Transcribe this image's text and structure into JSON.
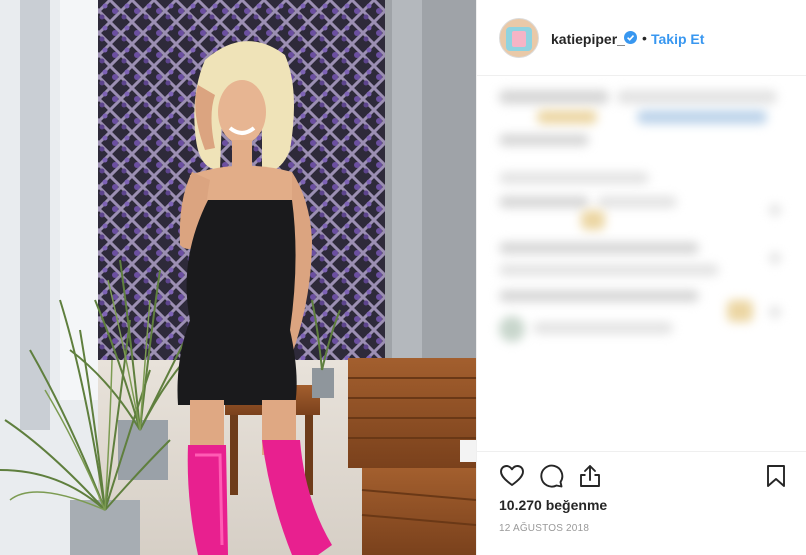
{
  "post": {
    "username": "katiepiper_",
    "separator": "•",
    "follow_label": "Takip Et",
    "likes_text": "10.270 beğenme",
    "date_text": "12 AĞUSTOS 2018"
  },
  "icons": {
    "verified": "verified-badge-icon",
    "like": "heart-icon",
    "comment": "comment-icon",
    "share": "share-icon",
    "save": "bookmark-icon"
  },
  "colors": {
    "link_blue": "#3897f0",
    "verified_blue": "#3897f0",
    "text": "#262626",
    "muted": "#999999",
    "boots": "#e8208f"
  }
}
